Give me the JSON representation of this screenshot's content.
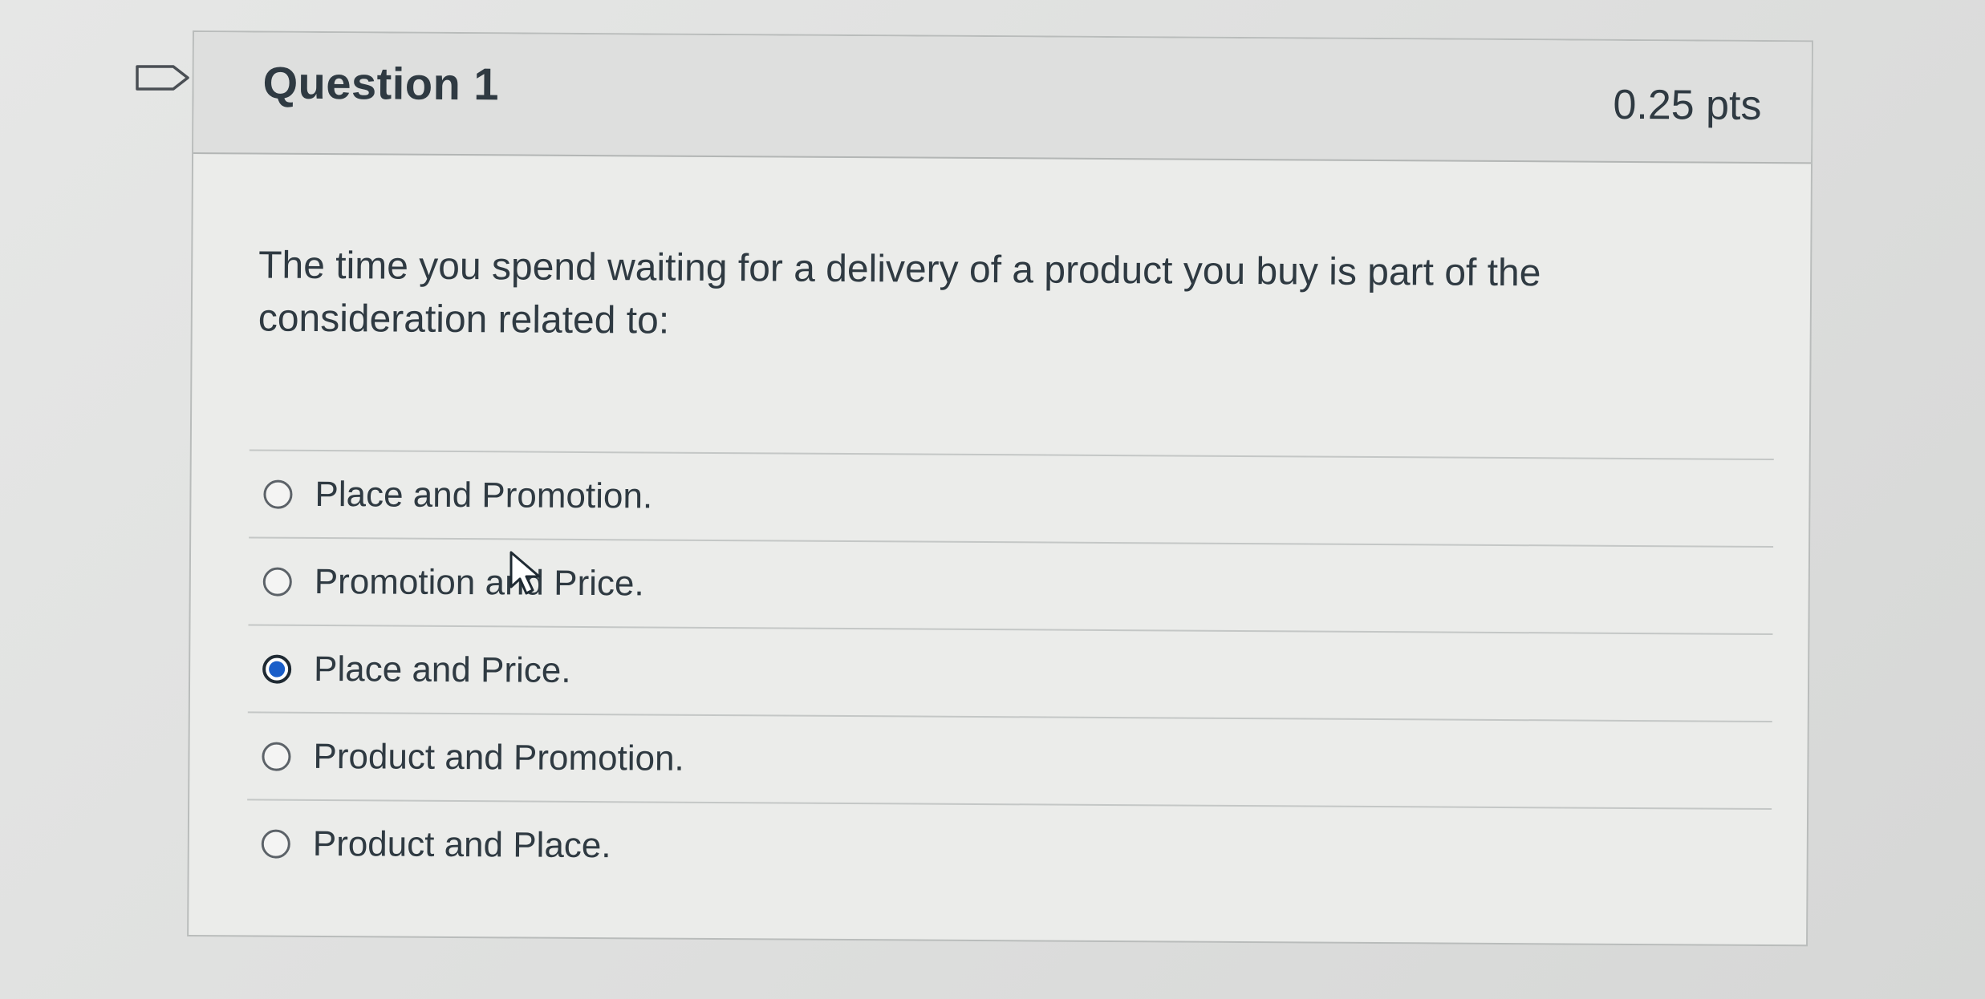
{
  "question": {
    "title": "Question 1",
    "points": "0.25 pts",
    "text": "The time you spend waiting for a delivery of a product you buy is part of the consideration related to:",
    "answers": [
      {
        "label": "Place and Promotion.",
        "selected": false
      },
      {
        "label": "Promotion and Price.",
        "selected": false
      },
      {
        "label": "Place and Price.",
        "selected": true
      },
      {
        "label": "Product and Promotion.",
        "selected": false
      },
      {
        "label": "Product and Place.",
        "selected": false
      }
    ]
  },
  "icons": {
    "flag": "flag-icon",
    "cursor": "mouse-pointer-icon"
  },
  "colors": {
    "selected_radio": "#1a5ec9",
    "text": "#2f3a42",
    "header_bg": "#dedfde"
  }
}
